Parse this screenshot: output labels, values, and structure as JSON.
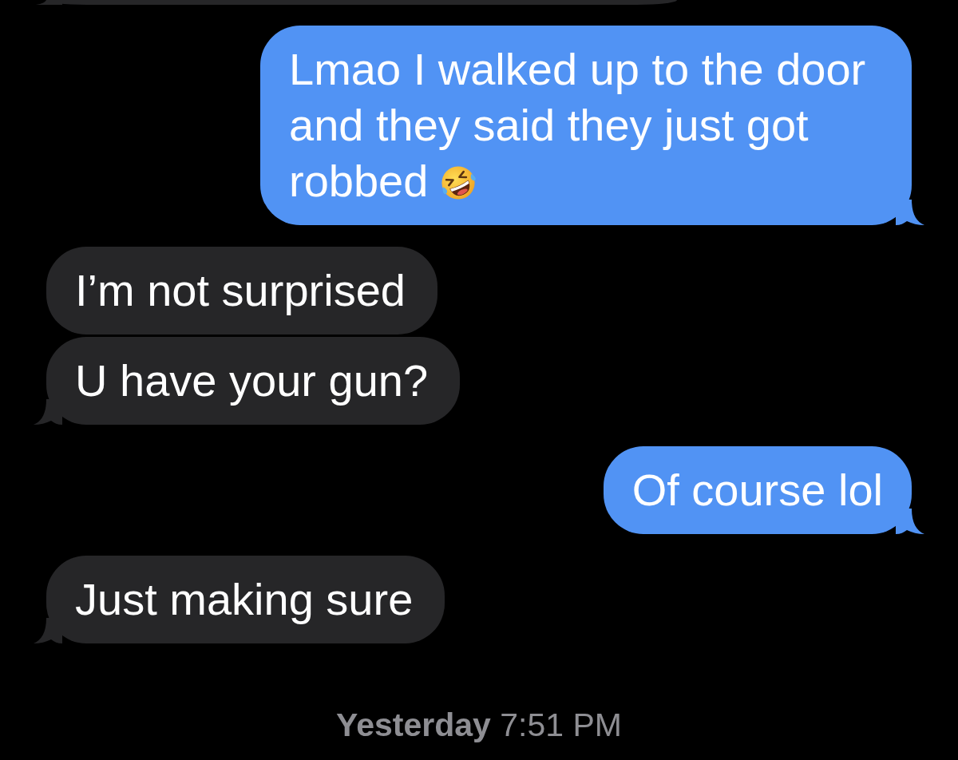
{
  "conversation": {
    "messages": [
      {
        "outgoing": false,
        "kind": "clipped",
        "tail": true,
        "emoji": false
      },
      {
        "outgoing": true,
        "kind": "text",
        "text": "Lmao I walked up to the door and they said they just got robbed",
        "emoji": true,
        "tail": true
      },
      {
        "outgoing": false,
        "kind": "text",
        "text": "I’m not surprised",
        "emoji": false,
        "tail": false
      },
      {
        "outgoing": false,
        "kind": "text",
        "text": "U have your gun?",
        "emoji": false,
        "tail": true
      },
      {
        "outgoing": true,
        "kind": "text",
        "text": "Of course lol",
        "emoji": false,
        "tail": true
      },
      {
        "outgoing": false,
        "kind": "text",
        "text": "Just making sure",
        "emoji": false,
        "tail": true
      }
    ],
    "timestamp": "**Yesterday** 7:51 PM"
  }
}
